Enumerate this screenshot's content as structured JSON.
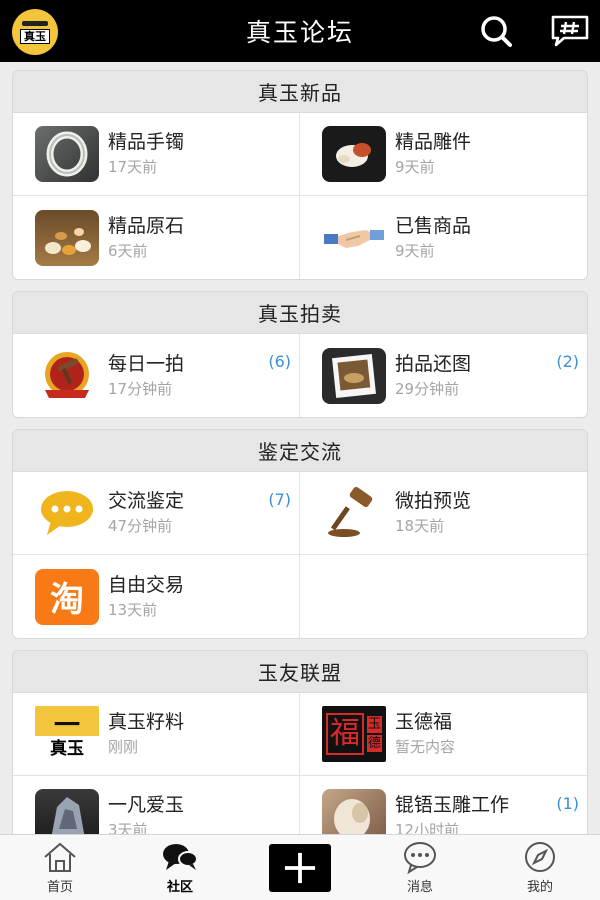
{
  "header": {
    "logo_text": "真玉",
    "title": "真玉论坛"
  },
  "sections": [
    {
      "title": "真玉新品",
      "items": [
        {
          "name": "精品手镯",
          "time": "17天前",
          "count": "",
          "icon": "bracelet-thumb"
        },
        {
          "name": "精品雕件",
          "time": "9天前",
          "count": "",
          "icon": "carving-thumb"
        },
        {
          "name": "精品原石",
          "time": "6天前",
          "count": "",
          "icon": "rough-stone-thumb"
        },
        {
          "name": "已售商品",
          "time": "9天前",
          "count": "",
          "icon": "handshake-thumb"
        }
      ]
    },
    {
      "title": "真玉拍卖",
      "items": [
        {
          "name": "每日一拍",
          "time": "17分钟前",
          "count": "(6)",
          "icon": "daily-auction-thumb"
        },
        {
          "name": "拍品还图",
          "time": "29分钟前",
          "count": "(2)",
          "icon": "photo-frame-thumb"
        }
      ]
    },
    {
      "title": "鉴定交流",
      "items": [
        {
          "name": "交流鉴定",
          "time": "47分钟前",
          "count": "(7)",
          "icon": "chat-bubble-thumb"
        },
        {
          "name": "微拍预览",
          "time": "18天前",
          "count": "",
          "icon": "gavel-thumb"
        },
        {
          "name": "自由交易",
          "time": "13天前",
          "count": "",
          "icon": "taobao-thumb"
        }
      ]
    },
    {
      "title": "玉友联盟",
      "items": [
        {
          "name": "真玉籽料",
          "time": "刚刚",
          "count": "",
          "icon": "zhenyu-logo-thumb"
        },
        {
          "name": "玉德福",
          "time": "暂无内容",
          "count": "",
          "icon": "yudefu-seal-thumb"
        },
        {
          "name": "一凡爱玉",
          "time": "3天前",
          "count": "",
          "icon": "stone-thumb"
        },
        {
          "name": "锟铻玉雕工作",
          "time": "12小时前",
          "count": "(1)",
          "icon": "jade-carving-thumb"
        }
      ]
    }
  ],
  "thumb_texts": {
    "taobao": "淘",
    "zhenyu_bar": "一",
    "zhenyu_text": "真玉",
    "seal_main": "福",
    "seal_side_1": "玉",
    "seal_side_2": "德"
  },
  "tabbar": {
    "home": "首页",
    "community": "社区",
    "messages": "消息",
    "mine": "我的"
  },
  "colors": {
    "header_bg": "#000000",
    "count_blue": "#3b8fd9",
    "logo_gold": "#f2c53d"
  }
}
